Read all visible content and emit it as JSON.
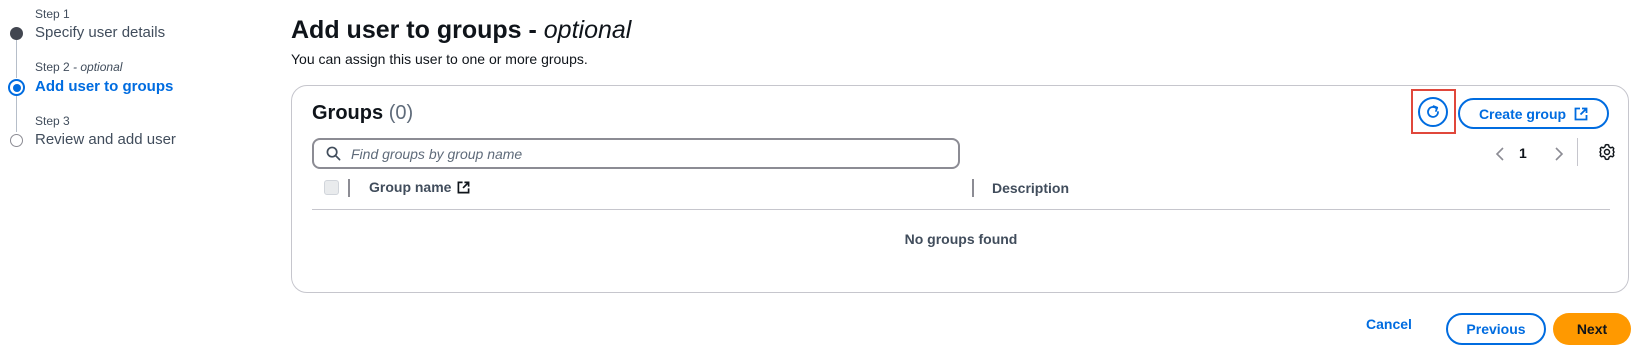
{
  "steps": [
    {
      "label": "Step 1",
      "title": "Specify user details",
      "state": "completed"
    },
    {
      "label": "Step 2",
      "label_suffix": "- optional",
      "title": "Add user to groups",
      "state": "current"
    },
    {
      "label": "Step 3",
      "title": "Review and add user",
      "state": "pending"
    }
  ],
  "header": {
    "title": "Add user to groups - ",
    "title_optional": "optional",
    "description": "You can assign this user to one or more groups."
  },
  "groups": {
    "heading": "Groups",
    "count": "(0)",
    "create_label": "Create group",
    "search_placeholder": "Find groups by group name",
    "search_value": "",
    "page": "1",
    "columns": [
      "Group name",
      "Description"
    ],
    "empty_text": "No groups found"
  },
  "footer": {
    "cancel_label": "Cancel",
    "previous_label": "Previous",
    "next_label": "Next"
  },
  "colors": {
    "accent": "#006ce0",
    "primary": "#ff9900",
    "completed_step": "#424650",
    "highlight": "#e0473b"
  },
  "icons": [
    "refresh-icon",
    "external-link-icon",
    "search-icon",
    "chevron-left-icon",
    "chevron-right-icon",
    "gear-icon"
  ]
}
